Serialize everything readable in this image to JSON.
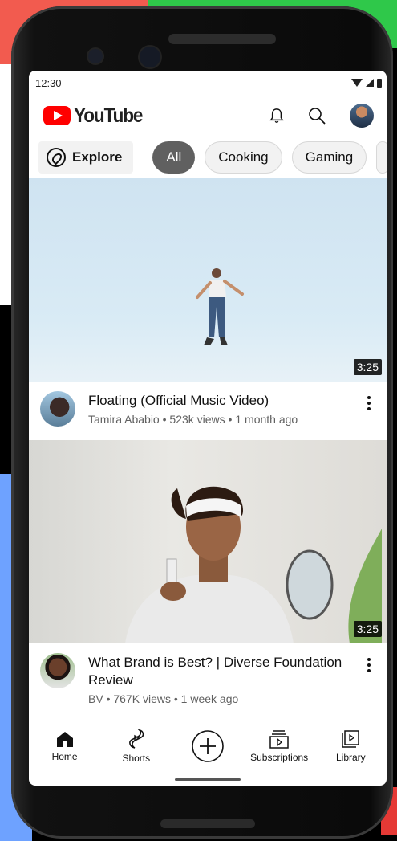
{
  "status": {
    "time": "12:30"
  },
  "header": {
    "logo_text": "YouTube",
    "icons": [
      "bell-icon",
      "search-icon",
      "avatar"
    ]
  },
  "chips": {
    "explore_label": "Explore",
    "items": [
      {
        "label": "All",
        "active": true
      },
      {
        "label": "Cooking",
        "active": false
      },
      {
        "label": "Gaming",
        "active": false
      }
    ]
  },
  "videos": [
    {
      "title": "Floating (Official Music Video)",
      "channel": "Tamira Ababio",
      "views": "523k views",
      "age": "1 month ago",
      "duration": "3:25"
    },
    {
      "title": "What Brand is Best? | Diverse Foundation Review",
      "channel": "BV",
      "views": "767K views",
      "age": "1 week ago",
      "duration": "3:25"
    }
  ],
  "nav": {
    "items": [
      {
        "label": "Home",
        "icon": "home-icon"
      },
      {
        "label": "Shorts",
        "icon": "shorts-icon"
      },
      {
        "label": "",
        "icon": "create-icon"
      },
      {
        "label": "Subscriptions",
        "icon": "subscriptions-icon"
      },
      {
        "label": "Library",
        "icon": "library-icon"
      }
    ]
  },
  "colors": {
    "brand": "#FF0000",
    "chip_active": "#606060",
    "chip_bg": "#F2F2F2",
    "text_secondary": "#606060"
  }
}
